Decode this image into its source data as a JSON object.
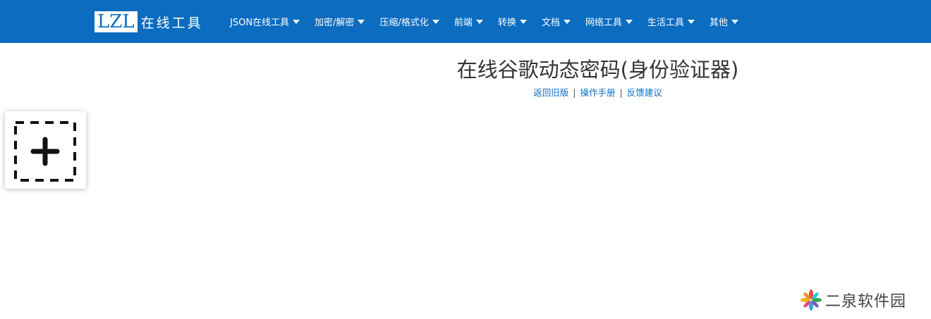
{
  "brand": {
    "logo_text": "LZL",
    "name": "在线工具"
  },
  "nav": {
    "items": [
      {
        "label": "JSON在线工具"
      },
      {
        "label": "加密/解密"
      },
      {
        "label": "压缩/格式化"
      },
      {
        "label": "前端"
      },
      {
        "label": "转换"
      },
      {
        "label": "文档"
      },
      {
        "label": "网络工具"
      },
      {
        "label": "生活工具"
      },
      {
        "label": "其他"
      }
    ]
  },
  "page": {
    "title": "在线谷歌动态密码(身份验证器)",
    "links": {
      "old_version": "返回旧版",
      "manual": "操作手册",
      "feedback": "反馈建议",
      "separator": "|"
    }
  },
  "add_card": {
    "icon": "add-icon"
  },
  "watermark": {
    "text": "二泉软件园",
    "icon": "pinwheel-logo-icon"
  },
  "colors": {
    "navbar": "#0b6cc0",
    "link": "#0b6cc0",
    "title": "#333333"
  }
}
